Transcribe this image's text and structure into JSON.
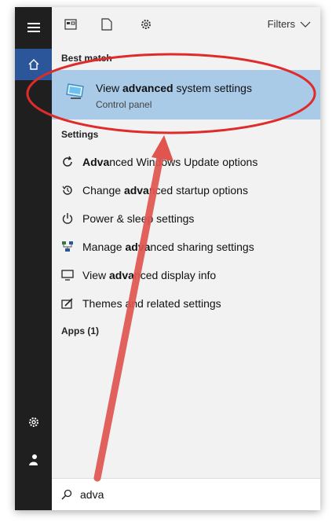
{
  "toolbar": {
    "filters_label": "Filters"
  },
  "best_match": {
    "heading": "Best match",
    "title_pre": "View ",
    "title_bold": "advanced",
    "title_post": " system settings",
    "subtitle": "Control panel"
  },
  "settings": {
    "heading": "Settings",
    "items": [
      {
        "pre": "",
        "bold": "Adva",
        "post": "nced Windows Update options",
        "icon": "refresh-icon"
      },
      {
        "pre": "Change ",
        "bold": "adva",
        "post": "nced startup options",
        "icon": "history-icon"
      },
      {
        "pre": "Power & sleep settings",
        "bold": "",
        "post": "",
        "icon": "power-icon"
      },
      {
        "pre": "Manage ",
        "bold": "adva",
        "post": "nced sharing settings",
        "icon": "network-sharing-icon"
      },
      {
        "pre": "View ",
        "bold": "adva",
        "post": "nced display info",
        "icon": "display-icon"
      },
      {
        "pre": "Themes and related settings",
        "bold": "",
        "post": "",
        "icon": "themes-icon"
      }
    ]
  },
  "apps": {
    "heading": "Apps (1)"
  },
  "search": {
    "value": "adva"
  },
  "colors": {
    "accent": "#2b579a",
    "highlight": "#a9cbe7",
    "annotation": "#e02b2b"
  }
}
